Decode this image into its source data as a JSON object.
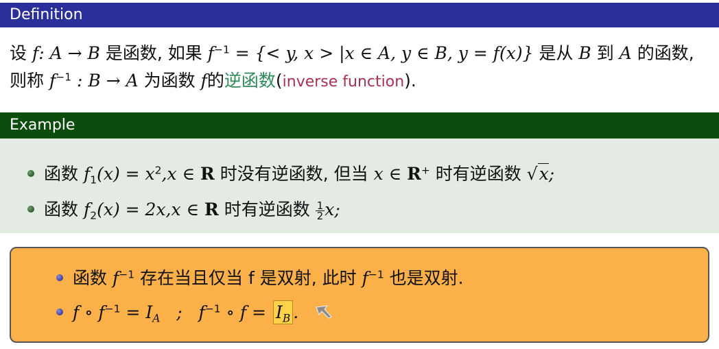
{
  "definition": {
    "header": "Definition",
    "line1": {
      "intro": "设",
      "f": "f",
      "colon_map": ": A → B ",
      "is_function": "是函数, 如果",
      "finv_base": "f",
      "finv_sup": "−1",
      "set_expr": " = {< y, x > |x ∈ A, y ∈ B, y = f(x)} ",
      "from_to_a": "是从",
      "B": "B",
      "to": "到",
      "A": "A",
      "tail": "的函数,"
    },
    "line2": {
      "then_call": "则称",
      "finv_base": "f",
      "finv_sup": "−1",
      "map": " : B → A ",
      "for_function": "为函数",
      "f": "f",
      "de": "的",
      "term_zh": "逆函数",
      "paren_open": "(",
      "term_en": "inverse function",
      "paren_close": ")."
    }
  },
  "example": {
    "header": "Example",
    "item1": {
      "label": "函数",
      "f_base": "f",
      "f_sub": "1",
      "expr_a": "(x) = x",
      "exp": "2",
      "expr_b": ",x ∈ ",
      "R": "R",
      "no_inverse": " 时没有逆函数, 但当",
      "x_in": "x ∈ ",
      "R2": "R",
      "plus": "+",
      "has_inverse": " 时有逆函数",
      "sqrt_sym": "√",
      "sqrt_arg": "x",
      "end": ";"
    },
    "item2": {
      "label": "函数",
      "f_base": "f",
      "f_sub": "2",
      "expr_a": "(x) = 2x,x ∈ ",
      "R": "R",
      "has_inverse": " 时有逆函数",
      "frac_num": "1",
      "frac_den": "2",
      "frac_var": "x",
      "end": ";"
    }
  },
  "highlight": {
    "item1": {
      "label": "函数",
      "finv_base": "f",
      "finv_sup": "−1",
      "text_a": " 存在当且仅当 f 是双射, 此时",
      "finv2_base": "f",
      "finv2_sup": "−1",
      "text_b": " 也是双射."
    },
    "item2": {
      "lhs": "f ∘ f",
      "lhs_sup": "−1",
      "eq1": " = I",
      "sub_a": "A",
      "sep": "   ;   ",
      "rhs_base": "f",
      "rhs_sup": "−1",
      "rhs_mid": " ∘ f = ",
      "ib_base": "I",
      "ib_sub": "B",
      "end": "."
    }
  },
  "colors": {
    "definition_header": "#2b2f9a",
    "example_header": "#0c4c0c",
    "example_body": "#e3ebe3",
    "highlight_box": "#fbb04a",
    "term_zh": "#2e8b57",
    "term_en": "#a8324f"
  },
  "icons": {
    "cursor": "cursor-arrow-icon"
  }
}
